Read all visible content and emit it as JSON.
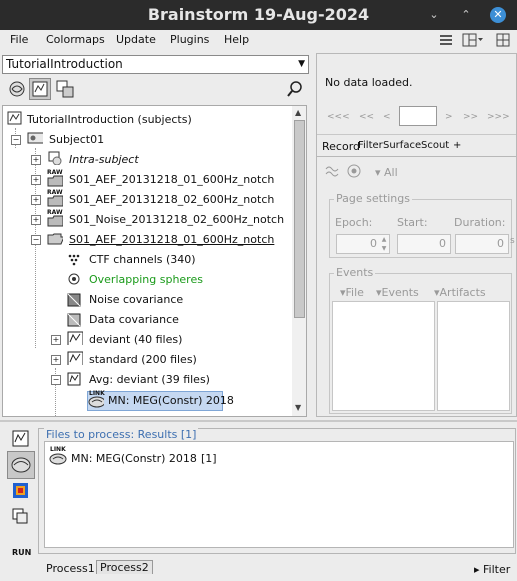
{
  "window": {
    "title": "Brainstorm 19-Aug-2024",
    "controls": [
      "⌄",
      "⌃",
      "✕"
    ]
  },
  "menubar": {
    "items": [
      "File",
      "Colormaps",
      "Update",
      "Plugins",
      "Help"
    ]
  },
  "left": {
    "protocol": "TutorialIntroduction",
    "tree": {
      "root": "TutorialIntroduction (subjects)",
      "subject": "Subject01",
      "intra": "Intra-subject",
      "run1": "S01_AEF_20131218_01_600Hz_notch",
      "run2": "S01_AEF_20131218_02_600Hz_notch",
      "noise": "S01_Noise_20131218_02_600Hz_notch",
      "run1b": "S01_AEF_20131218_01_600Hz_notch",
      "ctf": "CTF channels (340)",
      "spheres": "Overlapping spheres",
      "noisecov": "Noise covariance",
      "datacov": "Data covariance",
      "deviant": "deviant (40 files)",
      "standard": "standard (200 files)",
      "avg": "Avg: deviant (39 files)",
      "mn": "MN: MEG(Constr) 2018",
      "raw_tag": "RAW",
      "link_tag": "LINK"
    }
  },
  "right": {
    "status": "No data loaded.",
    "nav": [
      "<<<",
      "<<",
      "<",
      ">",
      ">>",
      ">>>"
    ],
    "tabs": [
      "Record",
      "Filter",
      "Surface",
      "Scout",
      "+"
    ],
    "all_label": "All",
    "page_settings": {
      "legend": "Page settings",
      "epoch": "Epoch:",
      "start": "Start:",
      "duration": "Duration:",
      "values": [
        "0",
        "0",
        "0"
      ],
      "unit": "s"
    },
    "events": {
      "legend": "Events",
      "file": "File",
      "events": "Events",
      "artifacts": "Artifacts"
    }
  },
  "bottom": {
    "header": "Files to process: Results [1]",
    "item": "MN: MEG(Constr) 2018",
    "count": "[1]",
    "link_tag": "LINK",
    "run": "RUN",
    "tabs": [
      "Process1",
      "Process2"
    ],
    "filter": "Filter"
  },
  "colors": {
    "accent": "#3d8fd6",
    "green": "#1a9a1a",
    "selected": "#c5d8f1",
    "titlebar": "#2b2b2b"
  }
}
